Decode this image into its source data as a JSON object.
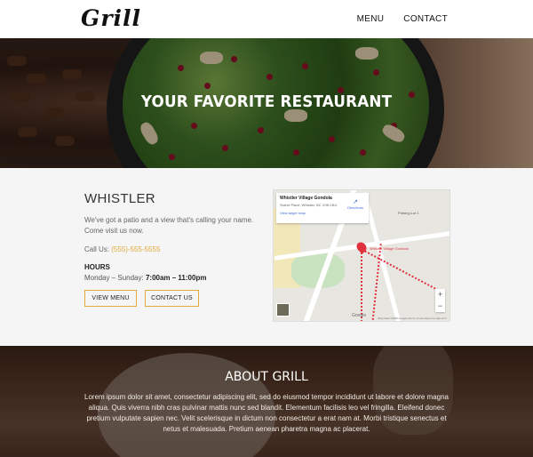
{
  "brand": {
    "logo": "Grill"
  },
  "nav": {
    "menu": "MENU",
    "contact": "CONTACT"
  },
  "hero": {
    "title": "YOUR FAVORITE RESTAURANT"
  },
  "location": {
    "city": "WHISTLER",
    "description": "We've got a patio and a view that's calling your name. Come visit us now.",
    "call_label": "Call Us:",
    "phone": "(555)-555-5555",
    "hours_label": "HOURS",
    "hours_days": "Monday – Sunday:",
    "hours_time": "7:00am – 11:00pm",
    "view_menu": "VIEW MENU",
    "contact_us": "CONTACT US"
  },
  "map": {
    "place": "Whistler Village Gondola",
    "address": "Sciere Place, Whistler, BC V0N 1B4",
    "larger": "View larger map",
    "directions": "Directions",
    "label_parking": "Parking Lot 1",
    "label_place": "Whistler Village Gondola",
    "zoom_in": "+",
    "zoom_out": "−",
    "google": "Google",
    "copyright": "Map data ©2025 Google  Terms of Use  Report a map error"
  },
  "about": {
    "title": "ABOUT GRILL",
    "text": "Lorem ipsum dolor sit amet, consectetur adipiscing elit, sed do eiusmod tempor incididunt ut labore et dolore magna aliqua. Quis viverra nibh cras pulvinar mattis nunc sed blandit. Elementum facilisis leo vel fringilla. Eleifend donec pretium vulputate sapien nec. Velit scelerisque in dictum non consectetur a erat nam at. Morbi tristique senectus et netus et malesuada. Pretium aenean pharetra magna ac placerat."
  }
}
